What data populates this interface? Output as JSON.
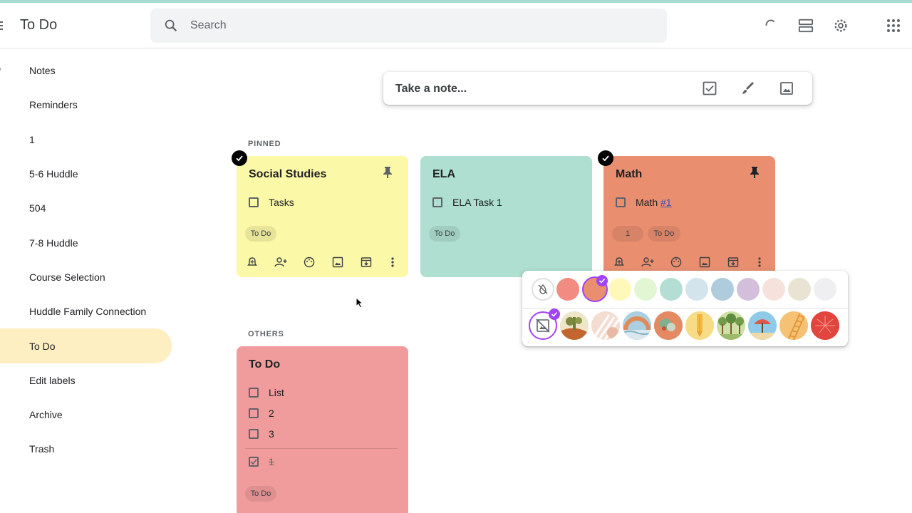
{
  "app": {
    "title": "To Do"
  },
  "search": {
    "placeholder": "Search"
  },
  "header_icons": [
    "refresh-icon",
    "list-view-icon",
    "settings-icon",
    "apps-grid-icon"
  ],
  "sidebar": {
    "items": [
      {
        "label": "Notes",
        "icon": "bulb-icon"
      },
      {
        "label": "Reminders",
        "icon": "bell-icon"
      },
      {
        "label": "1",
        "icon": "label-icon"
      },
      {
        "label": "5-6 Huddle",
        "icon": "label-icon"
      },
      {
        "label": "504",
        "icon": "label-icon"
      },
      {
        "label": "7-8 Huddle",
        "icon": "label-icon"
      },
      {
        "label": "Course Selection",
        "icon": "label-icon"
      },
      {
        "label": "Huddle Family Connection",
        "icon": "label-icon"
      },
      {
        "label": "To Do",
        "icon": "label-icon",
        "active": true
      },
      {
        "label": "Edit labels",
        "icon": "pencil-icon"
      },
      {
        "label": "Archive",
        "icon": "archive-icon"
      },
      {
        "label": "Trash",
        "icon": "trash-icon"
      }
    ]
  },
  "take_note": {
    "placeholder": "Take a note..."
  },
  "sections": {
    "pinned": "PINNED",
    "others": "OTHERS"
  },
  "colors": {
    "yellow": "#fbf8a8",
    "teal": "#aedfd0",
    "orange": "#e98f70",
    "red": "#f19c9c",
    "active_label": "#feefc3",
    "accent_purple": "#a142f4"
  },
  "notes": {
    "social_studies": {
      "title": "Social Studies",
      "items": [
        "Tasks"
      ],
      "label": "To Do",
      "pinned": true,
      "selected": true
    },
    "ela": {
      "title": "ELA",
      "items": [
        "ELA Task 1"
      ],
      "label": "To Do",
      "pinned": true
    },
    "math": {
      "title": "Math",
      "item_text": "Math ",
      "item_link": "#1",
      "labels": [
        "1",
        "To Do"
      ],
      "pinned": true,
      "selected": true
    },
    "todo": {
      "title": "To Do",
      "items": [
        "List",
        "2",
        "3"
      ],
      "checked_items": [
        "1"
      ],
      "label": "To Do"
    }
  },
  "palette": {
    "colors": [
      "none",
      "#f28b82",
      "#e98f70",
      "#fff8b8",
      "#e2f6d3",
      "#b4ddd3",
      "#d4e4ed",
      "#aeccdc",
      "#d3bfdb",
      "#f6e2dd",
      "#e9e3d4",
      "#efeff1"
    ],
    "selected_color": "#e98f70",
    "backgrounds": [
      "none",
      "groceries",
      "food",
      "music",
      "recipes",
      "notes",
      "places",
      "travel",
      "video",
      "celebration"
    ]
  }
}
